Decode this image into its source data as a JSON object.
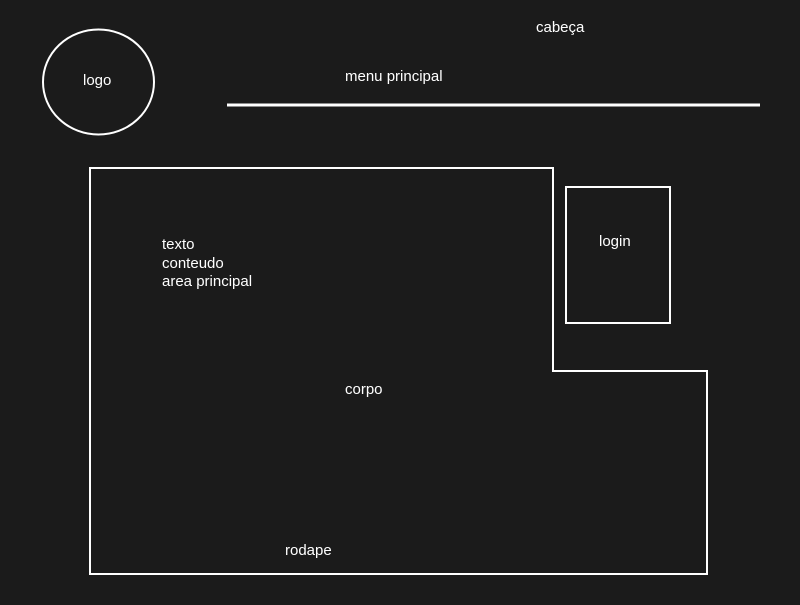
{
  "labels": {
    "header": "cabeça",
    "logo": "logo",
    "main_menu": "menu principal",
    "content_text": "texto\nconteudo\narea principal",
    "login": "login",
    "body": "corpo",
    "footer": "rodape"
  },
  "colors": {
    "background": "#1b1b1b",
    "stroke": "#ffffff",
    "text": "#ffffff"
  }
}
